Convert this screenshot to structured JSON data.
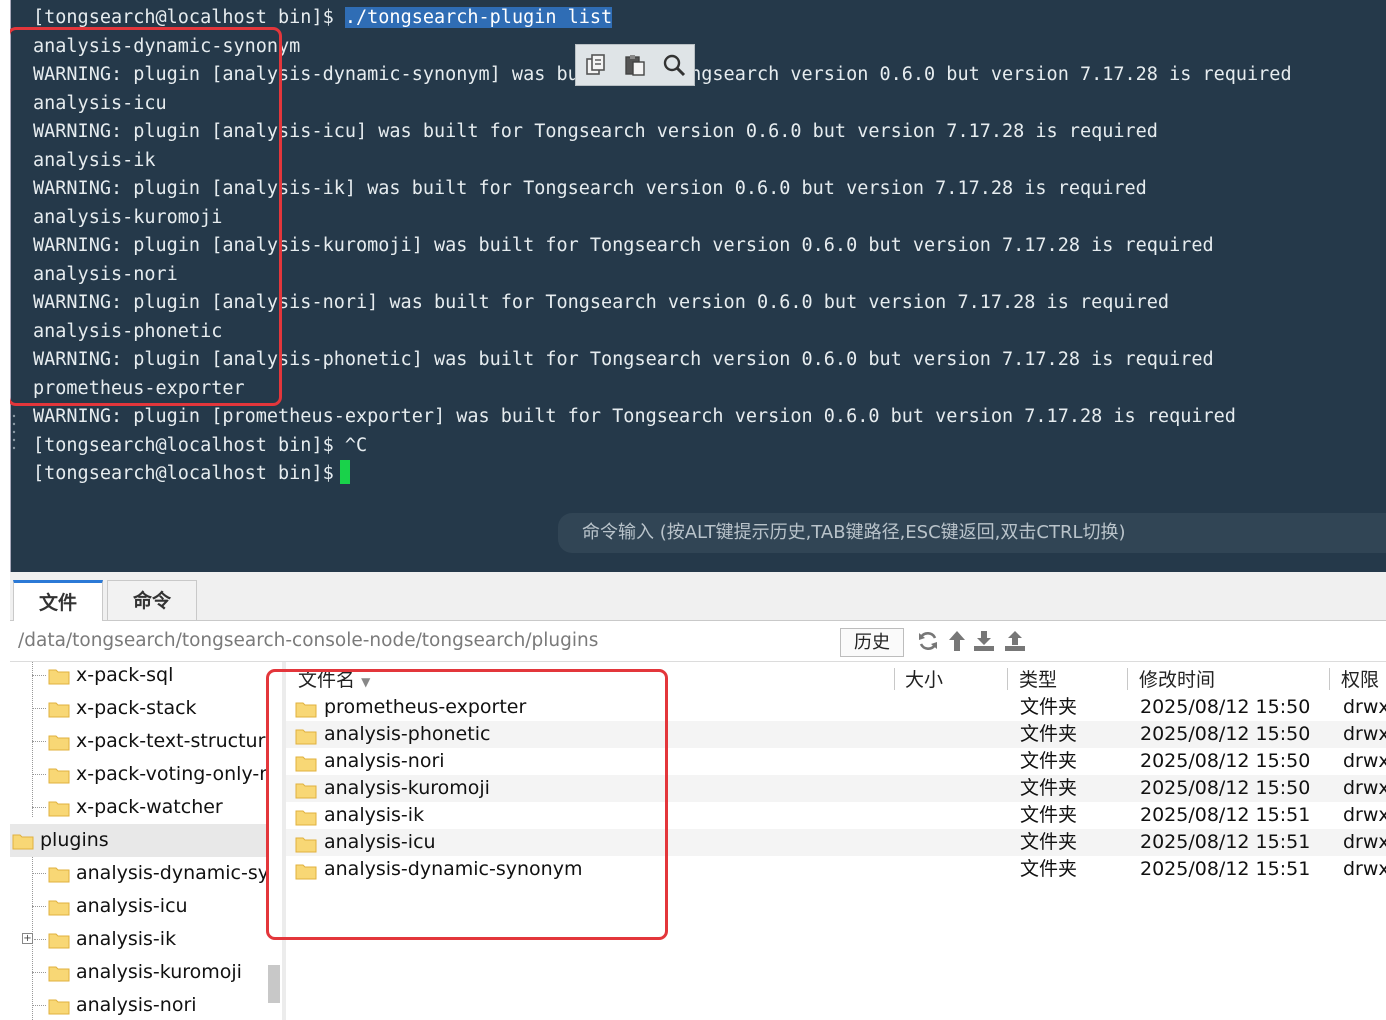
{
  "terminal": {
    "lines": [
      {
        "prompt": "[tongsearch@localhost bin]$ ",
        "command": "./tongsearch-plugin list"
      },
      {
        "text": "analysis-dynamic-synonym"
      },
      {
        "text": "WARNING: plugin [analysis-dynamic-synonym] was built for Tongsearch version 0.6.0 but version 7.17.28 is required"
      },
      {
        "text": "analysis-icu"
      },
      {
        "text": "WARNING: plugin [analysis-icu] was built for Tongsearch version 0.6.0 but version 7.17.28 is required"
      },
      {
        "text": "analysis-ik"
      },
      {
        "text": "WARNING: plugin [analysis-ik] was built for Tongsearch version 0.6.0 but version 7.17.28 is required"
      },
      {
        "text": "analysis-kuromoji"
      },
      {
        "text": "WARNING: plugin [analysis-kuromoji] was built for Tongsearch version 0.6.0 but version 7.17.28 is required"
      },
      {
        "text": "analysis-nori"
      },
      {
        "text": "WARNING: plugin [analysis-nori] was built for Tongsearch version 0.6.0 but version 7.17.28 is required"
      },
      {
        "text": "analysis-phonetic"
      },
      {
        "text": "WARNING: plugin [analysis-phonetic] was built for Tongsearch version 0.6.0 but version 7.17.28 is required"
      },
      {
        "text": "prometheus-exporter"
      },
      {
        "text": "WARNING: plugin [prometheus-exporter] was built for Tongsearch version 0.6.0 but version 7.17.28 is required"
      },
      {
        "text": "[tongsearch@localhost bin]$ ^C"
      },
      {
        "text": "[tongsearch@localhost bin]$"
      }
    ],
    "float_toolbar": {
      "icons": [
        "copy-icon",
        "paste-icon",
        "search-icon"
      ]
    },
    "command_hint": "命令输入 (按ALT键提示历史,TAB键路径,ESC键返回,双击CTRL切换)",
    "colors": {
      "background": "#25394a",
      "text": "#e6ecef",
      "cursor": "#19d24a",
      "highlight": "#e3363b"
    }
  },
  "tabs": [
    {
      "label": "文件",
      "active": true
    },
    {
      "label": "命令",
      "active": false
    }
  ],
  "pathbar": {
    "path": "/data/tongsearch/tongsearch-console-node/tongsearch/plugins",
    "history_label": "历史",
    "tool_icons": [
      "refresh-icon",
      "up-arrow-icon",
      "download-icon",
      "upload-icon"
    ]
  },
  "tree": {
    "items": [
      {
        "label": "x-pack-sql",
        "level": 2
      },
      {
        "label": "x-pack-stack",
        "level": 2
      },
      {
        "label": "x-pack-text-structure",
        "level": 2
      },
      {
        "label": "x-pack-voting-only-node",
        "level": 2
      },
      {
        "label": "x-pack-watcher",
        "level": 2
      },
      {
        "label": "plugins",
        "level": 1,
        "selected": true
      },
      {
        "label": "analysis-dynamic-synonym",
        "level": 2
      },
      {
        "label": "analysis-icu",
        "level": 2
      },
      {
        "label": "analysis-ik",
        "level": 2,
        "expandable": true
      },
      {
        "label": "analysis-kuromoji",
        "level": 2
      },
      {
        "label": "analysis-nori",
        "level": 2
      }
    ]
  },
  "filelist": {
    "columns": {
      "name": "文件名",
      "size": "大小",
      "type": "类型",
      "modified": "修改时间",
      "perm": "权限"
    },
    "rows": [
      {
        "name": "prometheus-exporter",
        "size": "",
        "type": "文件夹",
        "modified": "2025/08/12 15:50",
        "perm": "drwxr-xr-x"
      },
      {
        "name": "analysis-phonetic",
        "size": "",
        "type": "文件夹",
        "modified": "2025/08/12 15:50",
        "perm": "drwxr-xr-x"
      },
      {
        "name": "analysis-nori",
        "size": "",
        "type": "文件夹",
        "modified": "2025/08/12 15:50",
        "perm": "drwxr-xr-x"
      },
      {
        "name": "analysis-kuromoji",
        "size": "",
        "type": "文件夹",
        "modified": "2025/08/12 15:50",
        "perm": "drwxr-xr-x"
      },
      {
        "name": "analysis-ik",
        "size": "",
        "type": "文件夹",
        "modified": "2025/08/12 15:51",
        "perm": "drwxr-xr-x"
      },
      {
        "name": "analysis-icu",
        "size": "",
        "type": "文件夹",
        "modified": "2025/08/12 15:51",
        "perm": "drwxr-xr-x"
      },
      {
        "name": "analysis-dynamic-synonym",
        "size": "",
        "type": "文件夹",
        "modified": "2025/08/12 15:51",
        "perm": "drwxr-xr-x"
      }
    ]
  }
}
